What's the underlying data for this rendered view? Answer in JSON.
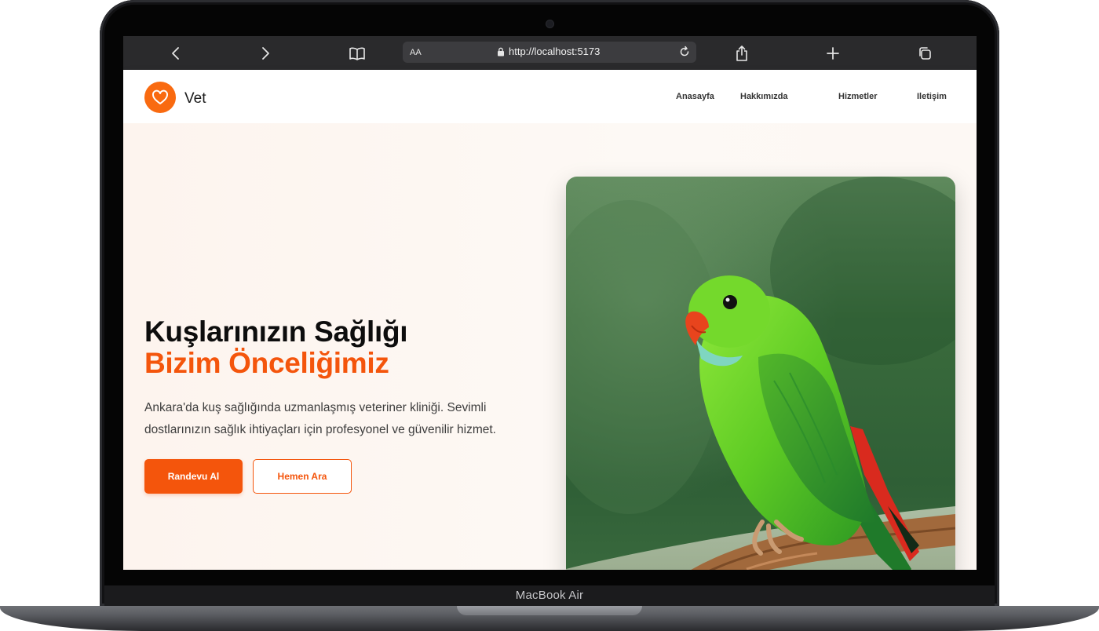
{
  "device": {
    "label": "MacBook Air"
  },
  "browser": {
    "url": "http://localhost:5173",
    "text_size_label": "AA"
  },
  "site": {
    "brand": "Vet",
    "nav": [
      {
        "label": "Anasayfa"
      },
      {
        "label": "Hakkımızda"
      },
      {
        "label": "Hizmetler"
      },
      {
        "label": "Iletişim"
      }
    ]
  },
  "hero": {
    "title_line1": "Kuşlarınızın Sağlığı",
    "title_line2": "Bizim Önceliğimiz",
    "description": "Ankara'da kuş sağlığında uzmanlaşmış veteriner kliniği. Sevimli dostlarınızın sağlık ihtiyaçları için profesyonel ve güvenilir hizmet.",
    "primary_button": "Randevu Al",
    "secondary_button": "Hemen Ara"
  },
  "colors": {
    "accent": "#f4550c",
    "logo": "#f96a10"
  },
  "icons": {
    "logo": "heart-icon",
    "toolbar": [
      "chevron-left-icon",
      "chevron-right-icon",
      "book-icon",
      "lock-icon",
      "reload-icon",
      "share-icon",
      "plus-icon",
      "tabs-icon"
    ]
  }
}
